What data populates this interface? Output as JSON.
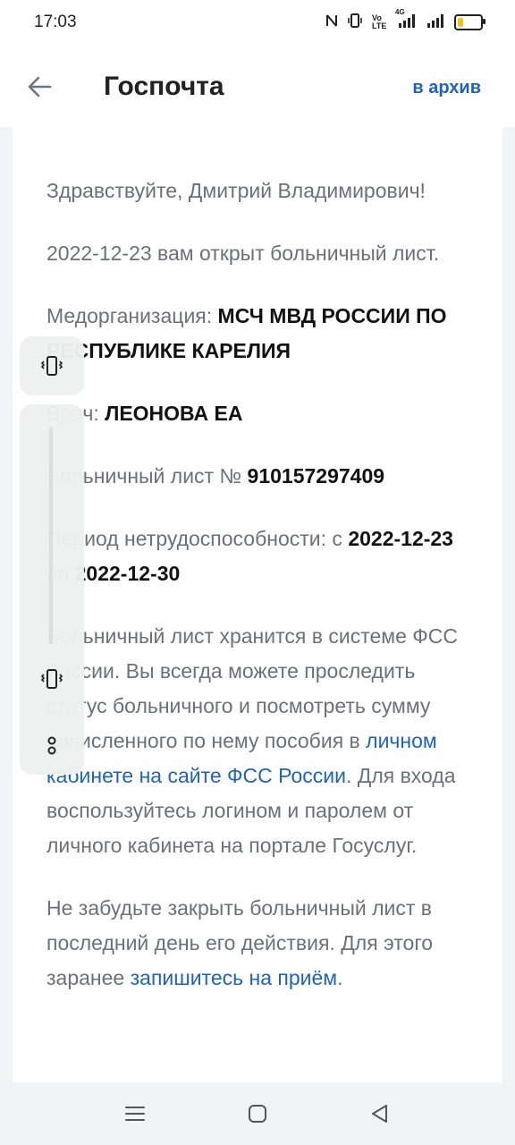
{
  "status_bar": {
    "time": "17:03",
    "icons": [
      "nfc-icon",
      "vibrate-icon",
      "volte-icon",
      "signal-4g-icon",
      "signal-icon",
      "battery-icon"
    ],
    "volte_label": "Vo LTE",
    "network_label": "4G"
  },
  "header": {
    "title": "Госпочта",
    "archive_label": "в архив"
  },
  "message": {
    "greeting": "Здравствуйте, Дмитрий Владимирович!",
    "opened_text": "2022-12-23 вам открыт больничный лист.",
    "org_label": "Медорганизация: ",
    "org_value": "МСЧ МВД РОССИИ ПО РЕСПУБЛИКЕ КАРЕЛИЯ",
    "doctor_label": "Врач: ",
    "doctor_value": "ЛЕОНОВА ЕА",
    "sheet_label": "Больничный лист № ",
    "sheet_number": "910157297409",
    "period_label": "Период нетрудоспособности: с ",
    "period_from": "2022-12-23",
    "period_to_label": " по ",
    "period_to": "2022-12-30",
    "storage_text_1": "Больничный лист хранится в системе ФСС России. Вы всегда можете проследить статус больничного и посмотреть сумму начисленного по нему пособия в ",
    "storage_link": "личном кабинете на сайте ФСС России",
    "storage_text_2": ". Для входа воспользуйтесь логином и паролем от личного кабинета на портале Госуслуг.",
    "reminder_text": "Не забудьте закрыть больничный лист в последний день его действия. Для этого заранее ",
    "reminder_link": "запишитесь на приём",
    "reminder_end": "."
  },
  "edge_panel": {
    "icons": [
      "vibrate-icon",
      "vibrate-icon",
      "more-icon"
    ]
  },
  "nav_bar": {
    "icons": [
      "menu-icon",
      "home-icon",
      "back-icon"
    ]
  },
  "colors": {
    "accent": "#1e63c4",
    "text_gray": "#6b717c",
    "text_dark": "#111111",
    "background": "#f2f3f5"
  }
}
